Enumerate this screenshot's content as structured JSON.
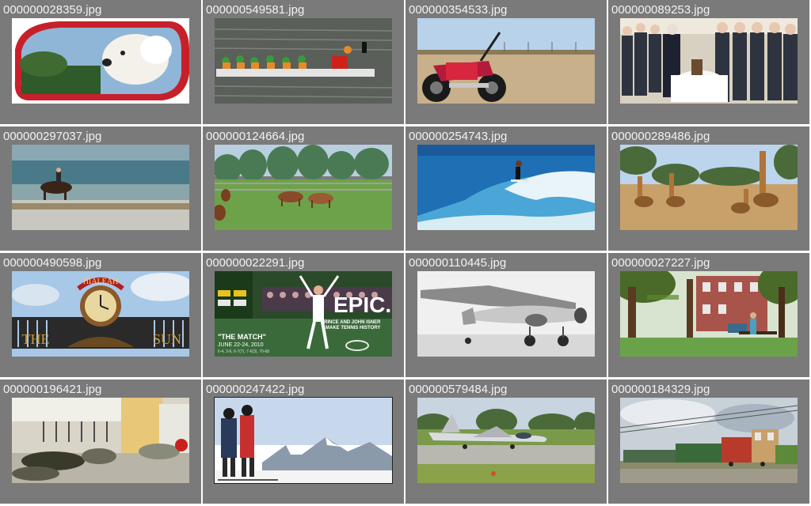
{
  "gallery": {
    "items": [
      {
        "filename": "000000028359.jpg",
        "subject": "dog-in-car-mirror"
      },
      {
        "filename": "000000549581.jpg",
        "subject": "dragon-boat-race"
      },
      {
        "filename": "000000354533.jpg",
        "subject": "motorcycle-in-field"
      },
      {
        "filename": "000000089253.jpg",
        "subject": "ceremony-cake-cutting"
      },
      {
        "filename": "000000297037.jpg",
        "subject": "horse-rider-on-beach"
      },
      {
        "filename": "000000124664.jpg",
        "subject": "horses-grazing"
      },
      {
        "filename": "000000254743.jpg",
        "subject": "surfer-on-wave"
      },
      {
        "filename": "000000289486.jpg",
        "subject": "giraffes-savanna"
      },
      {
        "filename": "000000490598.jpg",
        "subject": "clock-sign"
      },
      {
        "filename": "000000022291.jpg",
        "subject": "tennis-poster"
      },
      {
        "filename": "000000110445.jpg",
        "subject": "vintage-airplane"
      },
      {
        "filename": "000000027227.jpg",
        "subject": "park-bench"
      },
      {
        "filename": "000000196421.jpg",
        "subject": "airport-sleepers"
      },
      {
        "filename": "000000247422.jpg",
        "subject": "skiers-mountains"
      },
      {
        "filename": "000000579484.jpg",
        "subject": "jet-on-runway"
      },
      {
        "filename": "000000184329.jpg",
        "subject": "train-on-tracks"
      }
    ],
    "poster": {
      "headline": "EPIC.",
      "subline_1": "ISNER",
      "subline_2": "PRINCE AND JOHN ISNER",
      "subline_3": "MAKE TENNIS HISTORY",
      "match_title": "\"THE MATCH\"",
      "match_dates": "JUNE 22-24, 2010",
      "match_score": "6-4, 3-6, 6-7(7), 7-6(3), 70-68"
    },
    "sign_text": {
      "top": "HIALEAH",
      "bottom_left": "THE",
      "bottom_right": "SUN"
    }
  },
  "colors": {
    "cell_bg": "#7a7a7a",
    "label": "#f2f2f2",
    "separator": "#ffffff"
  }
}
